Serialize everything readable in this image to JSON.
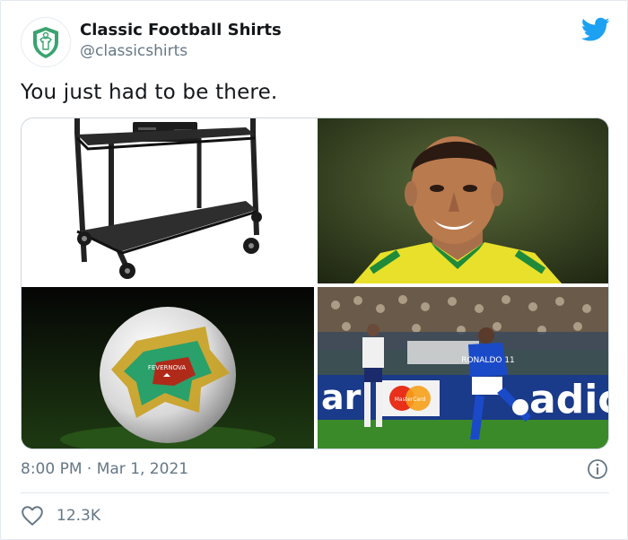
{
  "tweet": {
    "display_name": "Classic Football Shirts",
    "handle": "@classicshirts",
    "text": "You just had to be there.",
    "timestamp": "8:00 PM · Mar 1, 2021",
    "likes": "12.3K"
  },
  "media": {
    "ball_label": "FEVERNOVA",
    "jersey_text": "RONALDO 11",
    "ad_left": "ar",
    "ad_card": "MasterCard",
    "ad_right": "adic"
  },
  "colors": {
    "brand_green": "#3aa36f",
    "twitter_blue": "#1da1f2",
    "text_primary": "#14171a",
    "text_secondary": "#657786",
    "border": "#e1e8ed"
  },
  "icons": {
    "avatar": "shirt-shield-icon",
    "logo": "twitter-bird-icon",
    "info": "info-icon",
    "like": "heart-icon"
  }
}
